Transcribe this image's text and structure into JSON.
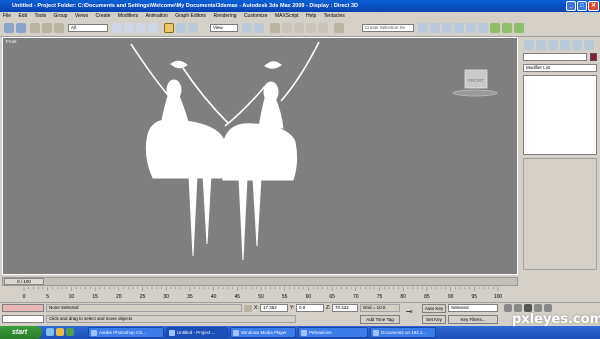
{
  "window": {
    "title": "Untitled    - Project Folder: C:\\Documents and Settings\\Welcome\\My Documents\\3dsmax     - Autodesk 3ds Max  2009         - Display : Direct 3D"
  },
  "menu": [
    "File",
    "Edit",
    "Tools",
    "Group",
    "Views",
    "Create",
    "Modifiers",
    "Animation",
    "Graph Editors",
    "Rendering",
    "Customize",
    "MAXScript",
    "Help",
    "Tentacles"
  ],
  "toolbar": {
    "filter_value": "All",
    "refcoord_value": "View",
    "named_selection_placeholder": "Create Selection Se"
  },
  "viewport": {
    "label": "Front",
    "viewcube_label": "FRONT",
    "bg_color": "#7f7f7f"
  },
  "command_panel": {
    "modifier_list_label": "Modifier List"
  },
  "timeline": {
    "frame_counter": "0 / 100",
    "ticks": [
      "0",
      "5",
      "10",
      "15",
      "20",
      "25",
      "30",
      "35",
      "40",
      "45",
      "50",
      "55",
      "60",
      "65",
      "70",
      "75",
      "80",
      "85",
      "90",
      "95",
      "100"
    ]
  },
  "status": {
    "selection": "None Selected",
    "prompt": "Click and drag to select and move objects",
    "x_label": "X:",
    "x_value": "17.362",
    "y_label": "Y:",
    "y_value": "0.0",
    "z_label": "Z:",
    "z_value": "70.432",
    "grid": "Grid = 10.0",
    "add_time_tag": "Add Time Tag",
    "auto_key": "Auto Key",
    "auto_key_value": "Selected",
    "set_key": "Set Key",
    "key_filters": "Key Filters..."
  },
  "taskbar": {
    "start_label": "start",
    "tasks": [
      "Adobe Photoshop CS...",
      "Untitled   - Project ...",
      "Windows Media Player",
      "Pehrasions",
      "Documents on 192.1..."
    ]
  },
  "watermark": "pxleyes.com"
}
